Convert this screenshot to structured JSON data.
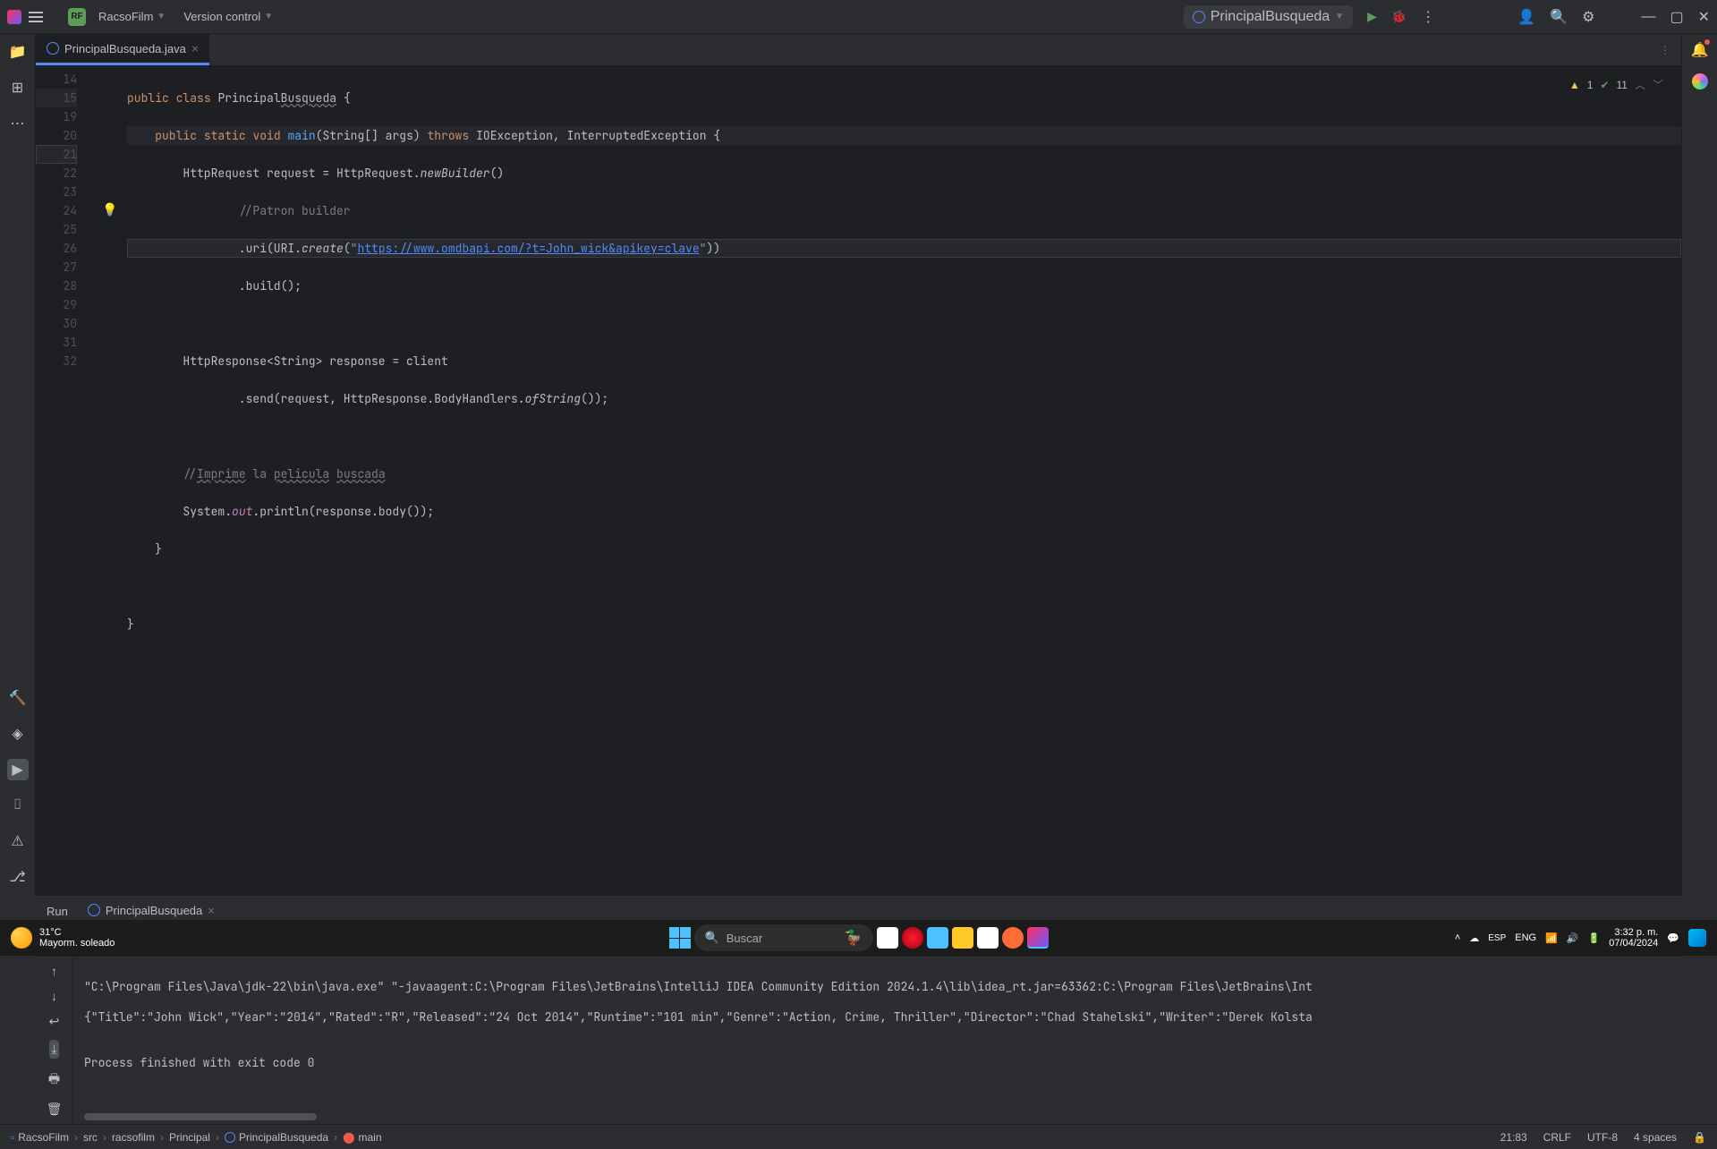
{
  "titlebar": {
    "project_name": "RacsoFilm",
    "project_initials": "RF",
    "version_control": "Version control",
    "run_config": "PrincipalBusqueda"
  },
  "tabs": {
    "file_name": "PrincipalBusqueda.java"
  },
  "inspections": {
    "warnings": "1",
    "typos": "11"
  },
  "code": {
    "lines": [
      "14",
      "15",
      "19",
      "20",
      "21",
      "22",
      "23",
      "24",
      "25",
      "26",
      "27",
      "28",
      "29",
      "30",
      "31",
      "32"
    ],
    "line14_public": "public",
    "line14_class": "class",
    "line14_name": "Principal",
    "line14_name2": "Busqueda",
    "line14_brace": " {",
    "line15_public": "public",
    "line15_static": "static",
    "line15_void": "void",
    "line15_main": "main",
    "line15_args": "(String[] args) ",
    "line15_throws": "throws",
    "line15_exc": " IOException, InterruptedException {",
    "line19_a": "        HttpRequest request = HttpRequest.",
    "line19_b": "newBuilder",
    "line19_c": "()",
    "line20": "                //Patron builder",
    "line21_a": "                .uri(URI.",
    "line21_b": "create",
    "line21_c": "(",
    "line21_d": "\"",
    "line21_url": "https://www.omdbapi.com/?t=John_wick&apikey=clave",
    "line21_e": "\"",
    "line21_f": "))",
    "line22": "                .build();",
    "line24": "        HttpResponse<String> response = client",
    "line25_a": "                .send(request, HttpResponse.BodyHandlers.",
    "line25_b": "ofString",
    "line25_c": "());",
    "line27_a": "        //",
    "line27_b": "Imprime",
    "line27_c": " la ",
    "line27_d": "pelicula",
    "line27_e": " ",
    "line27_f": "buscada",
    "line28_a": "        System.",
    "line28_b": "out",
    "line28_c": ".println(response.body());",
    "line29": "    }",
    "line31": "}"
  },
  "run_panel": {
    "label": "Run",
    "tab": "PrincipalBusqueda",
    "output_line1": "\"C:\\Program Files\\Java\\jdk-22\\bin\\java.exe\" \"-javaagent:C:\\Program Files\\JetBrains\\IntelliJ IDEA Community Edition 2024.1.4\\lib\\idea_rt.jar=63362:C:\\Program Files\\JetBrains\\Int",
    "output_line2": "{\"Title\":\"John Wick\",\"Year\":\"2014\",\"Rated\":\"R\",\"Released\":\"24 Oct 2014\",\"Runtime\":\"101 min\",\"Genre\":\"Action, Crime, Thriller\",\"Director\":\"Chad Stahelski\",\"Writer\":\"Derek Kolsta",
    "output_line3": "",
    "output_line4": "Process finished with exit code 0"
  },
  "breadcrumb": {
    "items": [
      "RacsoFilm",
      "src",
      "racsofilm",
      "Principal",
      "PrincipalBusqueda",
      "main"
    ]
  },
  "status": {
    "position": "21:83",
    "line_sep": "CRLF",
    "encoding": "UTF-8",
    "indent": "4 spaces"
  },
  "taskbar": {
    "temp": "31°C",
    "weather": "Mayorm. soleado",
    "search_placeholder": "Buscar",
    "lang": "ENG",
    "time": "3:32 p. m.",
    "date": "07/04/2024",
    "esp": "ESP"
  }
}
